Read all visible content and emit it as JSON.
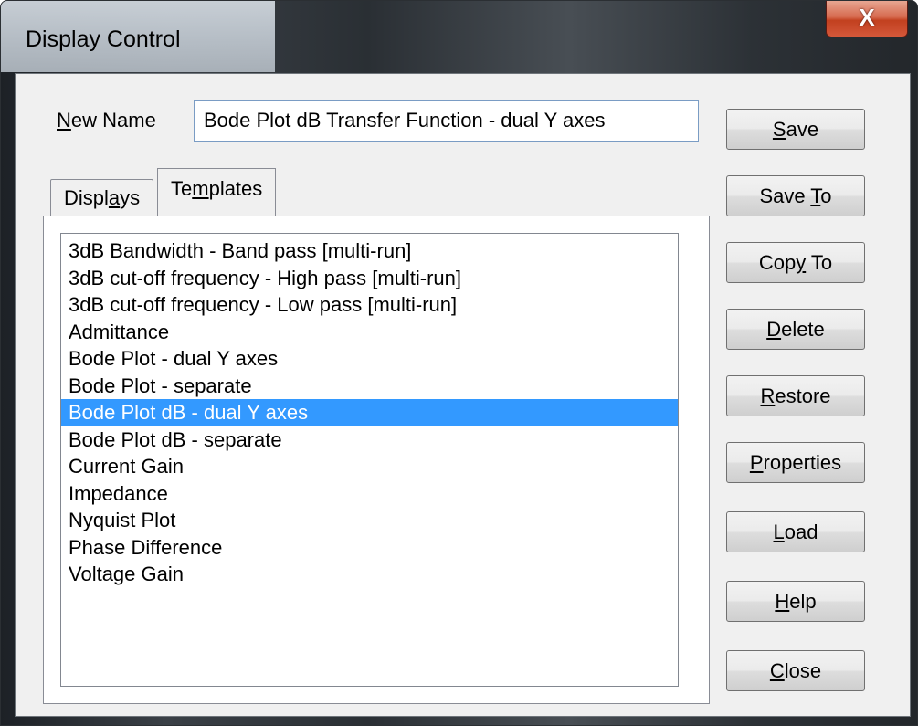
{
  "window": {
    "title": "Display Control",
    "close_glyph": "X"
  },
  "form": {
    "name_label_accel": "N",
    "name_label_rest": "ew Name",
    "name_value": "Bode Plot dB Transfer Function - dual Y axes"
  },
  "tabs": [
    {
      "label_pre": "Displ",
      "label_accel": "a",
      "label_post": "ys",
      "active": false
    },
    {
      "label_pre": "Te",
      "label_accel": "m",
      "label_post": "plates",
      "active": true
    }
  ],
  "templates_list": [
    "3dB Bandwidth - Band pass [multi-run]",
    "3dB cut-off frequency - High pass [multi-run]",
    "3dB cut-off frequency - Low pass [multi-run]",
    "Admittance",
    "Bode Plot - dual Y axes",
    "Bode Plot - separate",
    "Bode Plot dB - dual Y axes",
    "Bode Plot dB - separate",
    "Current Gain",
    "Impedance",
    "Nyquist Plot",
    "Phase Difference",
    "Voltage Gain"
  ],
  "selected_index": 6,
  "selection_color": "#3399ff",
  "buttons": [
    {
      "pre": "",
      "accel": "S",
      "post": "ave"
    },
    {
      "pre": "Save ",
      "accel": "T",
      "post": "o"
    },
    {
      "pre": "Cop",
      "accel": "y",
      "post": " To"
    },
    {
      "pre": "",
      "accel": "D",
      "post": "elete"
    },
    {
      "pre": "",
      "accel": "R",
      "post": "estore"
    },
    {
      "pre": "",
      "accel": "P",
      "post": "roperties"
    },
    {
      "pre": "",
      "accel": "L",
      "post": "oad"
    },
    {
      "pre": "",
      "accel": "H",
      "post": "elp"
    },
    {
      "pre": "",
      "accel": "C",
      "post": "lose"
    }
  ]
}
